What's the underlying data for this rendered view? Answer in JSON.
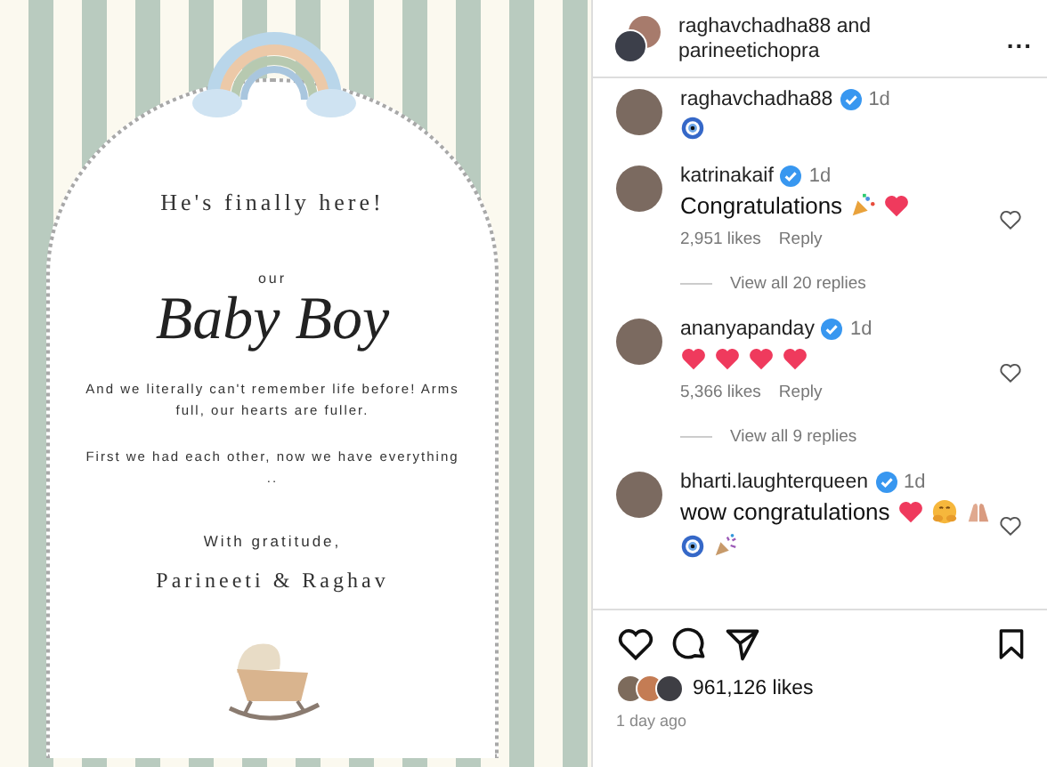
{
  "post": {
    "headline": "He's finally here!",
    "our": "our",
    "title": "Baby Boy",
    "paragraphs": [
      "And we literally can't remember life before! Arms full, our hearts are fuller.",
      "First we had each other, now we have everything .."
    ],
    "closing": "With gratitude,",
    "signature": "Parineeti & Raghav"
  },
  "header": {
    "names": "raghavchadha88 and parineetichopra",
    "more": "..."
  },
  "comments": [
    {
      "user": "raghavchadha88",
      "verified": true,
      "time": "1d",
      "emojis": [
        {
          "kind": "evil-eye"
        }
      ]
    },
    {
      "user": "katrinakaif",
      "verified": true,
      "time": "1d",
      "text": "Congratulations",
      "emojis": [
        {
          "kind": "confetti"
        },
        {
          "kind": "heart"
        }
      ],
      "likes": "2,951 likes",
      "reply": "Reply",
      "view_replies": "View all 20 replies"
    },
    {
      "user": "ananyapanday",
      "verified": true,
      "time": "1d",
      "emojis": [
        {
          "kind": "heart"
        },
        {
          "kind": "heart"
        },
        {
          "kind": "heart"
        },
        {
          "kind": "heart"
        }
      ],
      "likes": "5,366 likes",
      "reply": "Reply",
      "view_replies": "View all 9 replies"
    },
    {
      "user": "bharti.laughterqueen",
      "verified": true,
      "time": "1d",
      "text": "wow congratulations",
      "emojis": [
        {
          "kind": "heart"
        },
        {
          "kind": "hug"
        },
        {
          "kind": "hands"
        },
        {
          "kind": "evil-eye"
        },
        {
          "kind": "party"
        }
      ]
    }
  ],
  "likes": "961,126 likes",
  "posted": "1 day ago"
}
